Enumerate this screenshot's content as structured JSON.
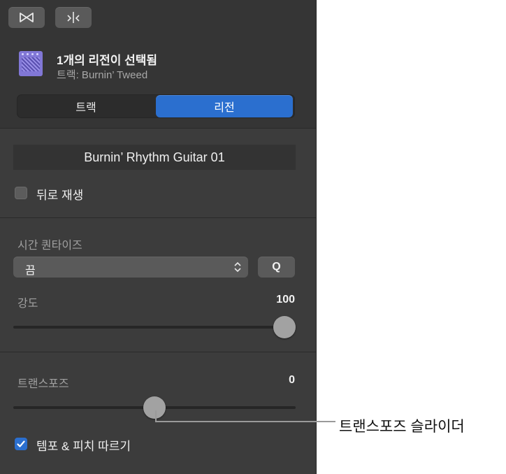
{
  "toolbar": {
    "buttons": [
      {
        "name": "region-toggle",
        "icon": "bowtie-icon"
      },
      {
        "name": "split",
        "icon": "split-arrows-icon"
      }
    ]
  },
  "header": {
    "icon": "amp-icon",
    "title": "1개의 리전이 선택됨",
    "subtitle": "트랙: Burnin’ Tweed"
  },
  "tabs": [
    {
      "label": "트랙",
      "active": false
    },
    {
      "label": "리전",
      "active": true
    }
  ],
  "region": {
    "name": "Burnin’ Rhythm Guitar 01",
    "reverse": {
      "label": "뒤로 재생",
      "checked": false
    }
  },
  "quantize": {
    "label": "시간 퀀타이즈",
    "selected": "끔",
    "q_button": "Q",
    "strength_label": "강도",
    "strength_value": "100",
    "strength_fraction": 1.0
  },
  "transpose": {
    "label": "트랜스포즈",
    "value": "0",
    "fraction": 0.5,
    "follow": {
      "label": "템포 & 피치 따르기",
      "checked": true
    }
  },
  "callout": {
    "text": "트랜스포즈 슬라이더"
  },
  "colors": {
    "accent": "#2b6fcf",
    "panel": "#3c3c3c",
    "icon": "#8177d6"
  }
}
